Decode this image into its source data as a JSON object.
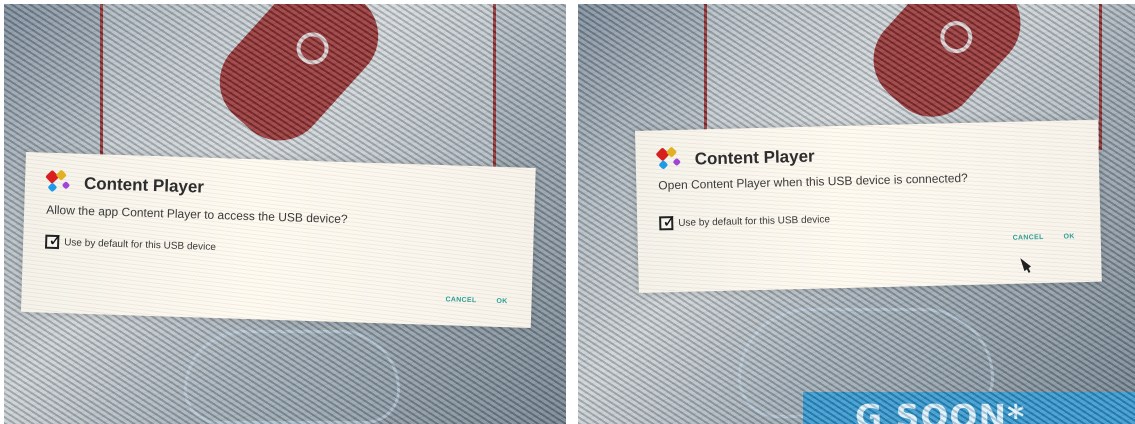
{
  "screens": [
    {
      "app": {
        "title": "Content Player",
        "icon": "content-player-app-icon"
      },
      "message": "Allow the app Content Player to access the USB device?",
      "default_option": {
        "label": "Use by default for this USB device",
        "checked": true
      },
      "buttons": {
        "cancel": "CANCEL",
        "ok": "OK"
      },
      "colors": {
        "accent": "#2e9f94",
        "usb_red": "#8b1f1f"
      }
    },
    {
      "app": {
        "title": "Content Player",
        "icon": "content-player-app-icon"
      },
      "message": "Open Content Player when this USB device is connected?",
      "default_option": {
        "label": "Use by default for this USB device",
        "checked": true
      },
      "buttons": {
        "cancel": "CANCEL",
        "ok": "OK"
      },
      "background_banner": "G SOON*",
      "colors": {
        "accent": "#2e9f94",
        "usb_red": "#8b1f1f",
        "banner_blue": "#1f8fcb"
      }
    }
  ]
}
